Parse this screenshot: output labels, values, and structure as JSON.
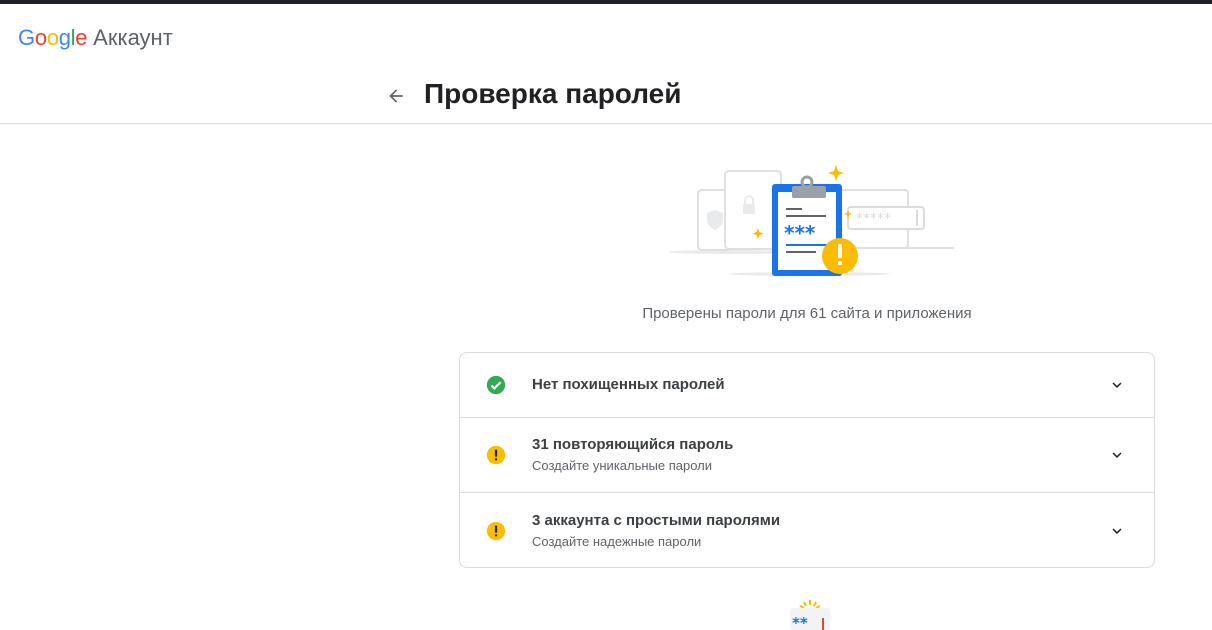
{
  "app": {
    "logo_text": "Google",
    "product_name": "Аккаунт"
  },
  "page": {
    "title": "Проверка паролей",
    "back_icon": "arrow-back-icon"
  },
  "summary": "Проверены пароли для 61 сайта и приложения",
  "checks": [
    {
      "title": "Нет похищенных паролей",
      "subtitle": "",
      "status": "ok",
      "status_icon": "check-circle-icon",
      "status_color": "#34a853"
    },
    {
      "title": "31 повторяющийся пароль",
      "subtitle": "Создайте уникальные пароли",
      "status": "warning",
      "status_icon": "warning-circle-icon",
      "status_color": "#fbbc04"
    },
    {
      "title": "3 аккаунта с простыми паролями",
      "subtitle": "Создайте надежные пароли",
      "status": "warning",
      "status_icon": "warning-circle-icon",
      "status_color": "#fbbc04"
    }
  ],
  "colors": {
    "google_blue": "#4285f4",
    "google_red": "#ea4335",
    "google_yellow": "#fbbc04",
    "google_green": "#34a853",
    "border": "#dadce0",
    "text_secondary": "#5f6368"
  }
}
